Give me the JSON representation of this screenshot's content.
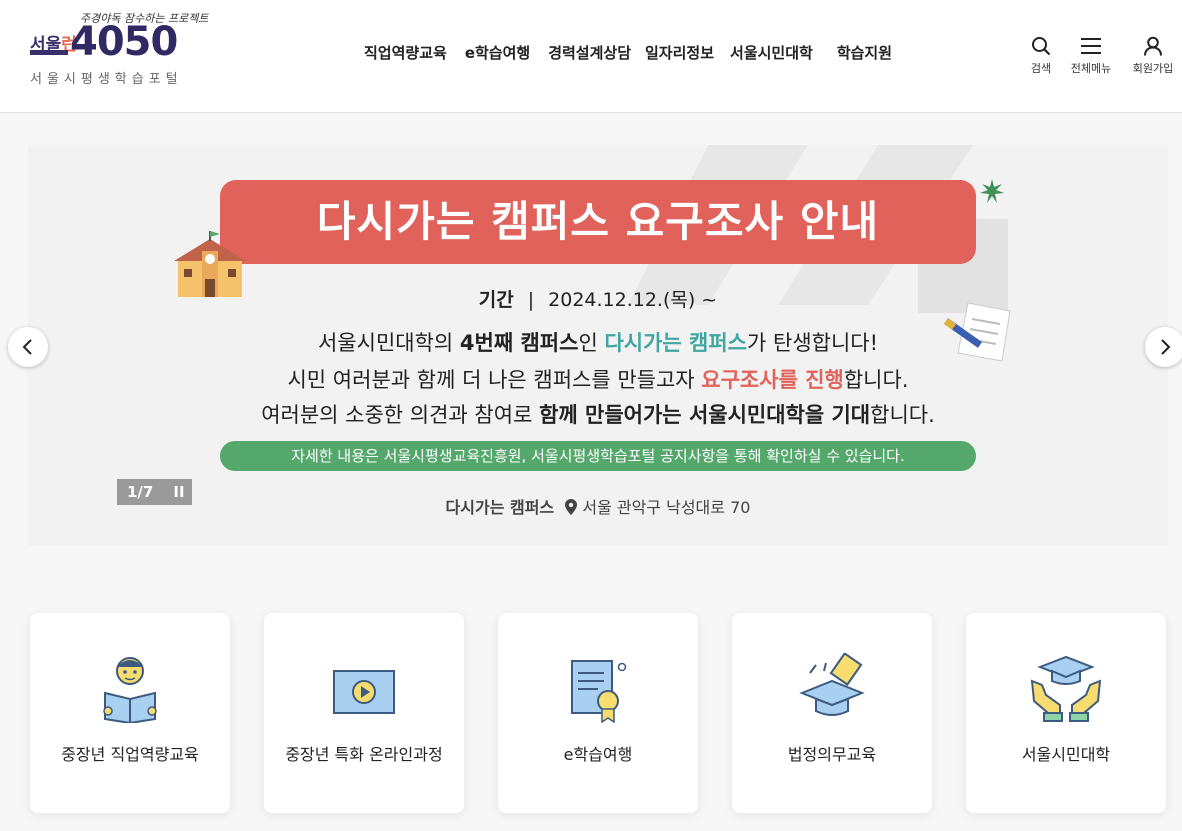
{
  "header": {
    "logo": {
      "slogan": "주경야독 잠수하는 프로젝트",
      "seoul_prefix": "서울",
      "seoul_accent": "런",
      "number": "4050",
      "portal": "서울시평생학습포털"
    },
    "nav": [
      {
        "label": "직업역량교육"
      },
      {
        "label": "e학습여행"
      },
      {
        "label": "경력설계상담"
      },
      {
        "label": "일자리정보"
      },
      {
        "label": "서울시민대학"
      },
      {
        "label": "학습지원"
      }
    ],
    "utils": {
      "search": "검색",
      "menu": "전체메뉴",
      "join": "회원가입"
    }
  },
  "banner": {
    "title": "다시가는 캠퍼스 요구조사 안내",
    "period_label": "기간",
    "period_sep": "|",
    "period_value": "2024.12.12.(목) ~",
    "line1": {
      "a": "서울시민대학의 ",
      "b": "4번째 캠퍼스",
      "c": "인 ",
      "d": "다시가는 캠퍼스",
      "e": "가 탄생합니다!"
    },
    "line2": {
      "a": "시민 여러분과 함께 더 나은 캠퍼스를 만들고자 ",
      "b": "요구조사를 진행",
      "c": "합니다."
    },
    "line3": {
      "a": "여러분의 소중한 의견과 참여로 ",
      "b": "함께 만들어가는 서울시민대학을 기대",
      "c": "합니다."
    },
    "note": "자세한 내용은 서울시평생교육진흥원, 서울시평생학습포털 공지사항을 통해 확인하실 수 있습니다.",
    "address_label": "다시가는 캠퍼스",
    "address": "서울 관악구 낙성대로 70",
    "pager": "1/7",
    "pause": "II"
  },
  "cards": [
    {
      "label": "중장년 직업역량교육",
      "icon": "reader-icon"
    },
    {
      "label": "중장년 특화 온라인과정",
      "icon": "video-play-icon"
    },
    {
      "label": "e학습여행",
      "icon": "certificate-icon"
    },
    {
      "label": "법정의무교육",
      "icon": "graduation-cap-icon"
    },
    {
      "label": "서울시민대학",
      "icon": "hands-cap-icon"
    }
  ],
  "colors": {
    "accent_red": "#e0625a",
    "teal": "#3fa7a0",
    "green": "#55a86b",
    "navy": "#2f2a63"
  }
}
